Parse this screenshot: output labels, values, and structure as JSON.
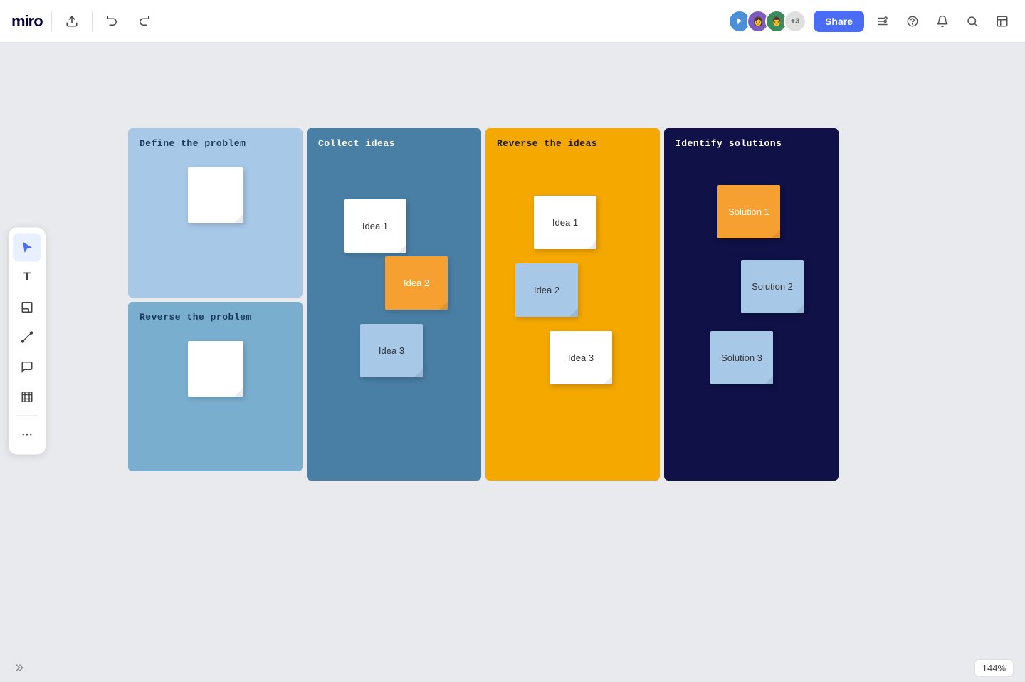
{
  "app": {
    "name": "miro"
  },
  "topbar": {
    "share_label": "Share",
    "avatars_extra": "+3"
  },
  "left_toolbar": {
    "tools": [
      {
        "id": "cursor",
        "label": "Cursor",
        "icon": "cursor-icon",
        "active": true
      },
      {
        "id": "text",
        "label": "Text",
        "icon": "text-icon",
        "active": false
      },
      {
        "id": "sticky",
        "label": "Sticky note",
        "icon": "sticky-icon",
        "active": false
      },
      {
        "id": "line",
        "label": "Line",
        "icon": "line-icon",
        "active": false
      },
      {
        "id": "comment",
        "label": "Comment",
        "icon": "comment-icon",
        "active": false
      },
      {
        "id": "frame",
        "label": "Frame",
        "icon": "frame-icon",
        "active": false
      },
      {
        "id": "more",
        "label": "More",
        "icon": "more-icon",
        "active": false
      }
    ]
  },
  "board": {
    "columns": [
      {
        "id": "define",
        "sub_sections": [
          {
            "title": "Define the problem",
            "bg": "#a8c8e8"
          },
          {
            "title": "Reverse the problem",
            "bg": "#7aaecf"
          }
        ]
      },
      {
        "id": "collect",
        "title": "Collect ideas",
        "bg": "#4a7fa5",
        "stickies": [
          {
            "label": "Idea 1",
            "bg": "#ffffff",
            "color": "#333"
          },
          {
            "label": "Idea 2",
            "bg": "#f5a030",
            "color": "#ffffff"
          },
          {
            "label": "Idea 3",
            "bg": "#a8c8e8",
            "color": "#333"
          }
        ]
      },
      {
        "id": "reverse",
        "title": "Reverse the ideas",
        "bg": "#f5a800",
        "stickies": [
          {
            "label": "Idea 1",
            "bg": "#ffffff",
            "color": "#333"
          },
          {
            "label": "Idea 2",
            "bg": "#a8c8e8",
            "color": "#333"
          },
          {
            "label": "Idea 3",
            "bg": "#ffffff",
            "color": "#333"
          }
        ]
      },
      {
        "id": "identify",
        "title": "Identify solutions",
        "bg": "#0f1147",
        "stickies": [
          {
            "label": "Solution 1",
            "bg": "#f5a030",
            "color": "#ffffff"
          },
          {
            "label": "Solution 2",
            "bg": "#a8c8e8",
            "color": "#333"
          },
          {
            "label": "Solution 3",
            "bg": "#a8c8e8",
            "color": "#333"
          }
        ]
      }
    ]
  },
  "zoom": {
    "level": "144%"
  }
}
